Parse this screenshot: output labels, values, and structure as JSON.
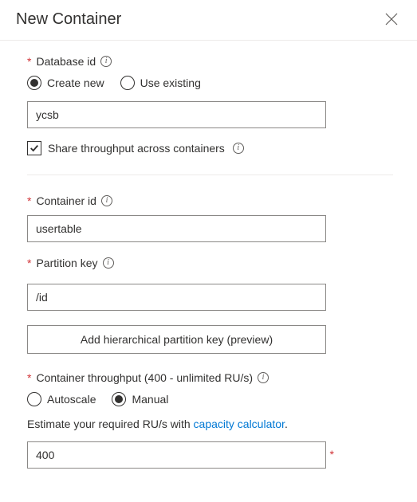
{
  "header": {
    "title": "New Container"
  },
  "database": {
    "label": "Database id",
    "radio_create": "Create new",
    "radio_existing": "Use existing",
    "value": "ycsb",
    "share_label": "Share throughput across containers"
  },
  "container": {
    "label": "Container id",
    "value": "usertable"
  },
  "partition": {
    "label": "Partition key",
    "value": "/id",
    "hierarchical_btn": "Add hierarchical partition key (preview)"
  },
  "throughput": {
    "label": "Container throughput (400 - unlimited RU/s)",
    "radio_autoscale": "Autoscale",
    "radio_manual": "Manual",
    "help_prefix": "Estimate your required RU/s with ",
    "help_link": "capacity calculator",
    "help_suffix": ".",
    "value": "400"
  }
}
